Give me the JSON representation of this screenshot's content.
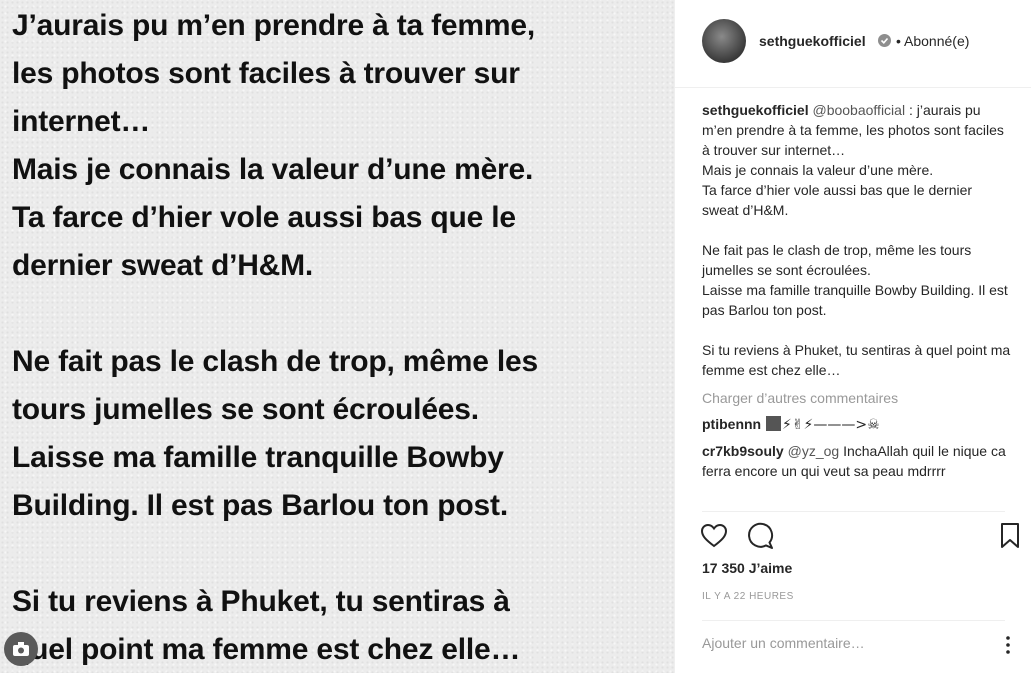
{
  "post": {
    "lines": [
      "J’aurais pu m’en prendre à ta femme,",
      "les photos sont faciles à trouver sur",
      "internet…",
      "Mais je connais la valeur d’une mère.",
      "Ta farce d’hier vole aussi bas que le",
      "dernier sweat d’H&M.",
      "Ne fait pas le clash de trop, même les",
      "tours jumelles se sont écroulées.",
      "Laisse ma famille tranquille Bowby",
      "Building. Il est pas Barlou ton post.",
      "Si tu reviens à Phuket, tu sentiras à",
      "quel point ma femme est chez elle…"
    ]
  },
  "header": {
    "username": "sethguekofficiel",
    "follow_status": "• Abonné(e)"
  },
  "caption": {
    "username": "sethguekofficiel",
    "mention": "@boobaofficial",
    "text": " : j’aurais pu m’en prendre à ta femme, les photos sont faciles à trouver sur internet…\nMais je connais la valeur d’une mère.\nTa farce d’hier vole aussi bas que le dernier sweat d’H&M.\n\nNe fait pas le clash de trop, même les tours jumelles se sont écroulées.\nLaisse ma famille tranquille Bowby Building. Il est pas Barlou ton post.\n\nSi tu reviens à Phuket, tu sentiras à quel point ma femme est chez elle…"
  },
  "load_more": "Charger d’autres commentaires",
  "comments": [
    {
      "username": "ptibennn",
      "text": "⚡✌⚡———>☠"
    },
    {
      "username": "cr7kb9souly",
      "mention": "@yz_og",
      "text": " InchaAllah quil le nique ca ferra encore un qui veut sa peau mdrrrr"
    }
  ],
  "likes": "17 350 J’aime",
  "timestamp": "IL Y A 22 HEURES",
  "add_comment_placeholder": "Ajouter un commentaire…",
  "icons": {
    "heart": "heart-icon",
    "comment": "comment-icon",
    "bookmark": "bookmark-icon",
    "verified": "verified-badge-icon",
    "camera": "camera-icon",
    "more": "more-options-icon"
  }
}
